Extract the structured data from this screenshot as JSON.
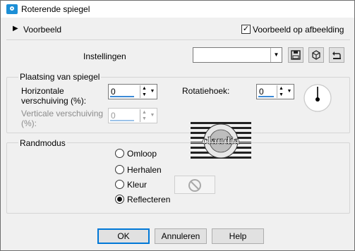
{
  "window": {
    "title": "Roterende spiegel"
  },
  "preview": {
    "label": "Voorbeeld",
    "checkbox_label": "Voorbeeld op afbeelding",
    "checkbox_checked": true
  },
  "settings": {
    "label": "Instellingen",
    "value": ""
  },
  "placement": {
    "legend": "Plaatsing van spiegel",
    "horizontal_label_1": "Horizontale",
    "horizontal_label_2": "verschuiving (%):",
    "horizontal_value": "0",
    "vertical_label_1": "Verticale verschuiving",
    "vertical_label_2": "(%):",
    "vertical_value": "0",
    "rotation_label": "Rotatiehoek:",
    "rotation_value": "0"
  },
  "mode": {
    "legend": "Randmodus",
    "options": [
      "Omloop",
      "Herhalen",
      "Kleur",
      "Reflecteren"
    ],
    "selected": "Reflecteren"
  },
  "watermark": {
    "text": "claudia"
  },
  "buttons": {
    "ok": "OK",
    "cancel": "Annuleren",
    "help": "Help"
  },
  "icons": [
    "app-icon",
    "save-icon",
    "delete-icon",
    "reset-icon",
    "disabled-color-icon",
    "angle-dial-icon",
    "dropdown-arrow-icon"
  ]
}
